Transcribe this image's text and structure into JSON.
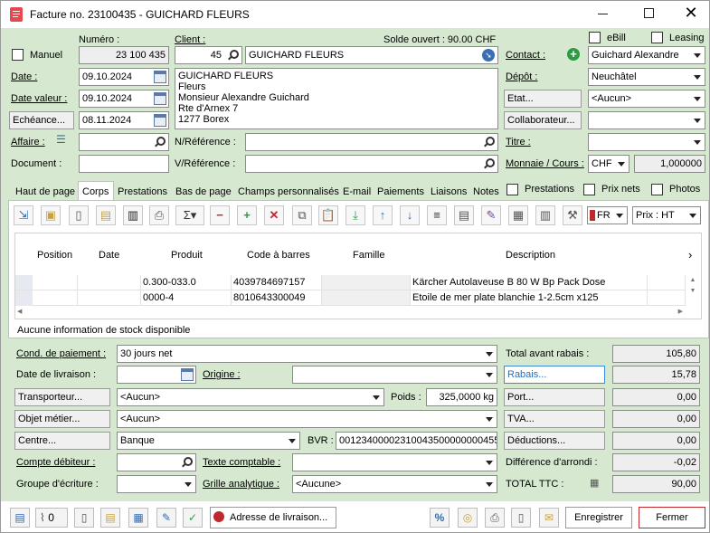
{
  "window": {
    "title": "Facture no. 23100435 - GUICHARD FLEURS",
    "minimize_icon": "minimize-icon",
    "maximize_icon": "maximize-icon",
    "close_icon": "close-icon"
  },
  "header": {
    "numero_label": "Numéro :",
    "numero": "23 100 435",
    "manuel_label": "Manuel",
    "client_label": "Client :",
    "client_no": "45",
    "client_name": "GUICHARD FLEURS",
    "solde": "Solde ouvert : 90.00 CHF",
    "date_label": "Date :",
    "date": "09.10.2024",
    "date_valeur_label": "Date valeur :",
    "date_valeur": "09.10.2024",
    "echeance_label": "Echéance...",
    "echeance": "08.11.2024",
    "affaire_label": "Affaire :",
    "document_label": "Document :",
    "address": [
      "GUICHARD FLEURS",
      "Fleurs",
      "Monsieur Alexandre Guichard",
      "Rte d'Arnex 7",
      "1277 Borex"
    ],
    "n_ref_label": "N/Référence :",
    "v_ref_label": "V/Référence :",
    "ebill_label": "eBill",
    "leasing_label": "Leasing",
    "contact_label": "Contact :",
    "contact": "Guichard Alexandre",
    "depot_label": "Dépôt :",
    "depot": "Neuchâtel",
    "etat_label": "Etat...",
    "etat": "<Aucun>",
    "collaborateur_label": "Collaborateur...",
    "titre_label": "Titre :",
    "monnaie_label": "Monnaie / Cours :",
    "monnaie": "CHF",
    "cours": "1,000000"
  },
  "tabs": [
    "Haut de page",
    "Corps",
    "Prestations",
    "Bas de page",
    "Champs personnalisés",
    "E-mail",
    "Paiements",
    "Liaisons",
    "Notes"
  ],
  "tab_options": {
    "prestations": "Prestations",
    "prix_nets": "Prix nets",
    "photos": "Photos"
  },
  "toolbar": {
    "language": "FR",
    "prix": "Prix : HT"
  },
  "grid": {
    "columns": [
      "Position",
      "Date",
      "Produit",
      "Code à barres",
      "Famille",
      "Description"
    ],
    "rows": [
      {
        "position": "",
        "date": "",
        "produit": "0.300-033.0",
        "code": "4039784697157",
        "famille": "",
        "description": "Kärcher Autolaveuse B 80 W Bp Pack Dose"
      },
      {
        "position": "",
        "date": "",
        "produit": "0000-4",
        "code": "8010643300049",
        "famille": "",
        "description": "Etoile de mer plate blanchie 1-2.5cm  x125"
      }
    ],
    "stock_info": "Aucune information de stock disponible"
  },
  "footer": {
    "cond_paiement_label": "Cond. de paiement :",
    "cond_paiement": "30 jours net",
    "date_livraison_label": "Date de livraison :",
    "origine_label": "Origine :",
    "transporteur_label": "Transporteur...",
    "transporteur": "<Aucun>",
    "poids_label": "Poids :",
    "poids": "325,0000 kg",
    "objet_label": "Objet métier...",
    "objet": "<Aucun>",
    "centre_label": "Centre...",
    "centre": "Banque",
    "bvr_label": "BVR :",
    "bvr": "00123400002310043500000000455",
    "compte_label": "Compte débiteur :",
    "texte_label": "Texte comptable :",
    "groupe_label": "Groupe d'écriture :",
    "grille_label": "Grille analytique :",
    "grille": "<Aucune>"
  },
  "totals": {
    "avant_rabais_label": "Total avant rabais :",
    "avant_rabais": "105,80",
    "rabais_label": "Rabais...",
    "rabais": "15,78",
    "port_label": "Port...",
    "port": "0,00",
    "tva_label": "TVA...",
    "tva": "0,00",
    "deductions_label": "Déductions...",
    "deductions": "0,00",
    "arrondi_label": "Différence d'arrondi :",
    "arrondi": "-0,02",
    "ttc_label": "TOTAL TTC :",
    "ttc": "90,00"
  },
  "bottom": {
    "attach_count": "0",
    "adresse_livraison": "Adresse de livraison...",
    "enregistrer": "Enregistrer",
    "fermer": "Fermer"
  },
  "colors": {
    "panel": "#d6e9d0",
    "accent_red": "#c0282c",
    "accent_blue": "#2e6cb5",
    "accent_green": "#2f9a45"
  }
}
